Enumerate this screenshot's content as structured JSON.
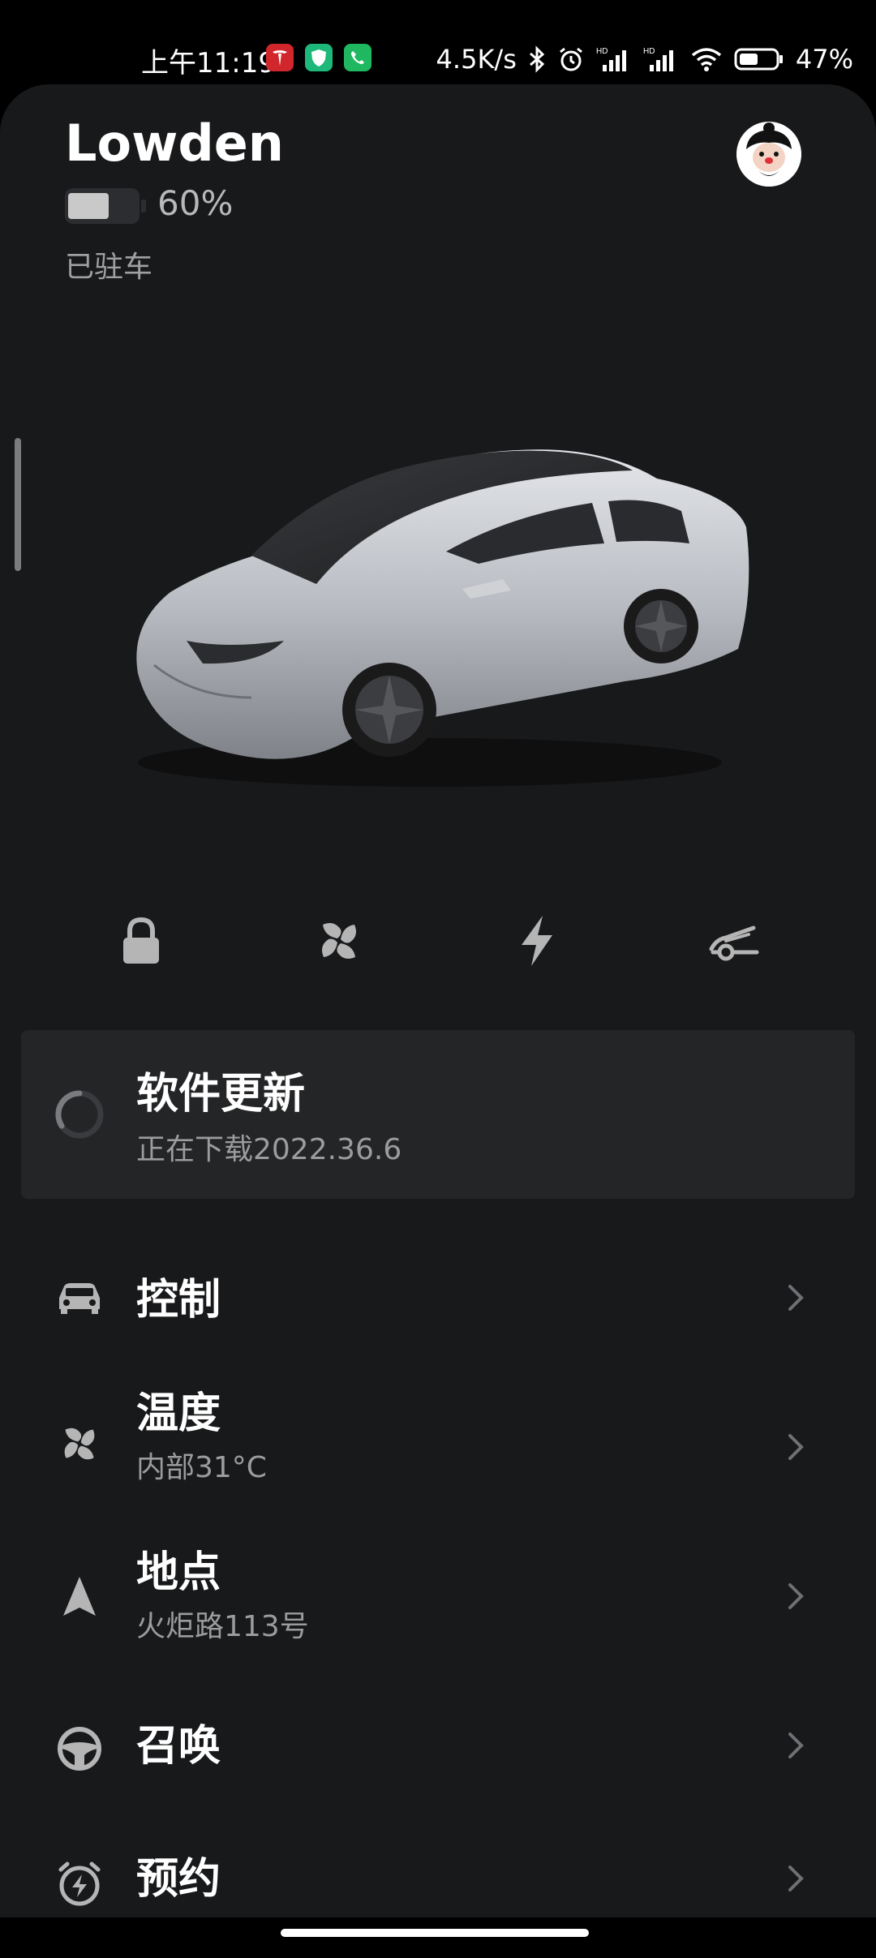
{
  "status_bar": {
    "time": "上午11:19",
    "net_speed": "4.5K/s",
    "battery": "47%",
    "icons": [
      "tesla-app-icon",
      "shield-app-icon",
      "phone-app-icon",
      "bluetooth-icon",
      "alarm-icon",
      "hd-signal-icon",
      "hd-signal-icon",
      "wifi-icon",
      "battery-icon"
    ]
  },
  "vehicle": {
    "name": "Lowden",
    "battery_percent_label": "60%",
    "battery_level": 0.6,
    "status": "已驻车"
  },
  "quick_controls": [
    "lock-icon",
    "fan-icon",
    "bolt-icon",
    "frunk-icon"
  ],
  "software_update": {
    "title": "软件更新",
    "subtitle": "正在下载2022.36.6"
  },
  "menu": {
    "items": [
      {
        "title": "控制",
        "subtitle": "",
        "icon": "car-icon"
      },
      {
        "title": "温度",
        "subtitle": "内部31°C",
        "icon": "fan-icon"
      },
      {
        "title": "地点",
        "subtitle": "火炬路113号",
        "icon": "navigation-arrow-icon"
      },
      {
        "title": "召唤",
        "subtitle": "",
        "icon": "steering-wheel-icon"
      },
      {
        "title": "预约",
        "subtitle": "",
        "icon": "alarm-bolt-icon"
      }
    ]
  },
  "colors": {
    "background": "#18191b",
    "card": "#242527",
    "text_primary": "#ffffff",
    "text_secondary": "#9c9c9c",
    "icon": "#b5b5b5"
  }
}
